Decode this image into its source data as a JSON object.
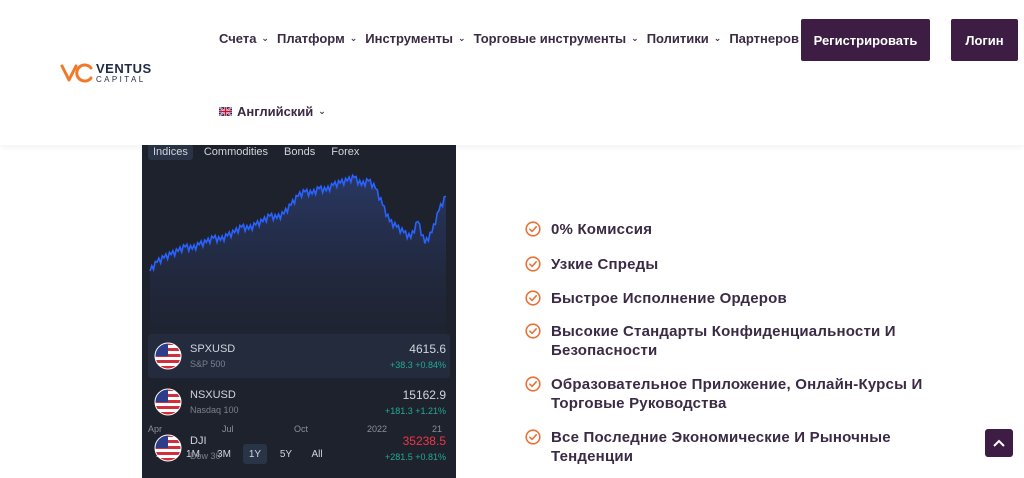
{
  "brand": {
    "name": "VENTUS",
    "sub": "CAPITAL"
  },
  "nav": [
    {
      "label": "Счета",
      "dropdown": true
    },
    {
      "label": "Платформ",
      "dropdown": true
    },
    {
      "label": "Инструменты",
      "dropdown": true
    },
    {
      "label": "Торговые инструменты",
      "dropdown": true
    },
    {
      "label": "Политики",
      "dropdown": true
    },
    {
      "label": "Партнеров",
      "dropdown": false
    }
  ],
  "language": {
    "label": "Английский",
    "flag": "uk-flag-icon"
  },
  "buttons": {
    "register": "Регистрировать",
    "login": "Логин"
  },
  "widget": {
    "tabs": [
      "Indices",
      "Commodities",
      "Bonds",
      "Forex"
    ],
    "active_tab": "Indices",
    "x_labels": [
      "Apr",
      "Jul",
      "Oct",
      "2022",
      "21"
    ],
    "ranges": [
      "1D",
      "1M",
      "3M",
      "1Y",
      "5Y",
      "All"
    ],
    "active_range": "1Y",
    "symbols": [
      {
        "name": "SPXUSD",
        "desc": "S&P 500",
        "price": "4615.6",
        "change": "+38.3  +0.84%",
        "price_color": "neutral"
      },
      {
        "name": "NSXUSD",
        "desc": "Nasdaq 100",
        "price": "15162.9",
        "change": "+181.3  +1.21%",
        "price_color": "neutral"
      },
      {
        "name": "DJI",
        "desc": "Dow 30",
        "price": "35238.5",
        "change": "+281.5  +0.81%",
        "price_color": "red"
      }
    ]
  },
  "chart_data": {
    "type": "area",
    "x": [
      "Apr",
      "Jul",
      "Oct",
      "2022",
      "21"
    ],
    "series": [
      {
        "values": [
          0.1,
          0.18,
          0.22,
          0.25,
          0.28,
          0.32,
          0.3,
          0.34,
          0.36,
          0.4,
          0.38,
          0.42,
          0.45,
          0.5,
          0.48,
          0.52,
          0.55,
          0.6,
          0.58,
          0.62,
          0.7,
          0.78,
          0.82,
          0.8,
          0.85,
          0.83,
          0.88,
          0.9,
          0.92,
          0.95,
          0.88,
          0.92,
          0.85,
          0.7,
          0.55,
          0.5,
          0.45,
          0.4,
          0.55,
          0.35,
          0.45,
          0.65,
          0.78
        ]
      }
    ],
    "colors": {
      "line": "#2962ff",
      "fill": "#1e2a4a"
    }
  },
  "features": [
    "0% Комиссия",
    "Узкие Спреды",
    "Быстрое Исполнение Ордеров",
    "Высокие Стандарты Конфиденциальности И Безопасности",
    "Образовательное Приложение, Онлайн-Курсы И Торговые Руководства",
    "Все Последние Экономические И Рыночные Тенденции"
  ],
  "colors": {
    "accent": "#3d1d44",
    "check": "#e8733a"
  }
}
